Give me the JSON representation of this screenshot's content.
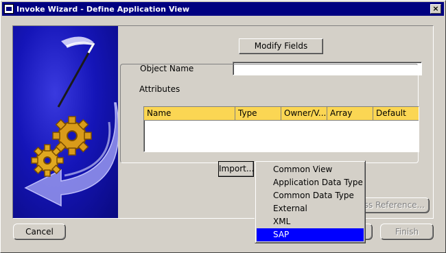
{
  "window": {
    "title": "Invoke Wizard - Define Application View",
    "close_label": "×"
  },
  "form": {
    "modify_fields_label": "Modify Fields",
    "object_name_label": "Object Name",
    "object_name_value": ""
  },
  "attributes": {
    "group_label": "Attributes",
    "columns": [
      "Name",
      "Type",
      "Owner/V...",
      "Array",
      "Default"
    ],
    "rows": [],
    "import_label": "Import...",
    "cross_reference_label": "ss Reference..."
  },
  "context_menu": {
    "items": [
      "Common View",
      "Application Data Type",
      "Common Data Type",
      "External",
      "XML",
      "SAP"
    ],
    "selected": "SAP"
  },
  "footer": {
    "cancel_label": "Cancel",
    "finish_label": "Finish"
  },
  "colors": {
    "title_bar": "#000080",
    "table_header": "#fbd653",
    "menu_selection": "#0000ff",
    "image_background": "#1515b8"
  }
}
